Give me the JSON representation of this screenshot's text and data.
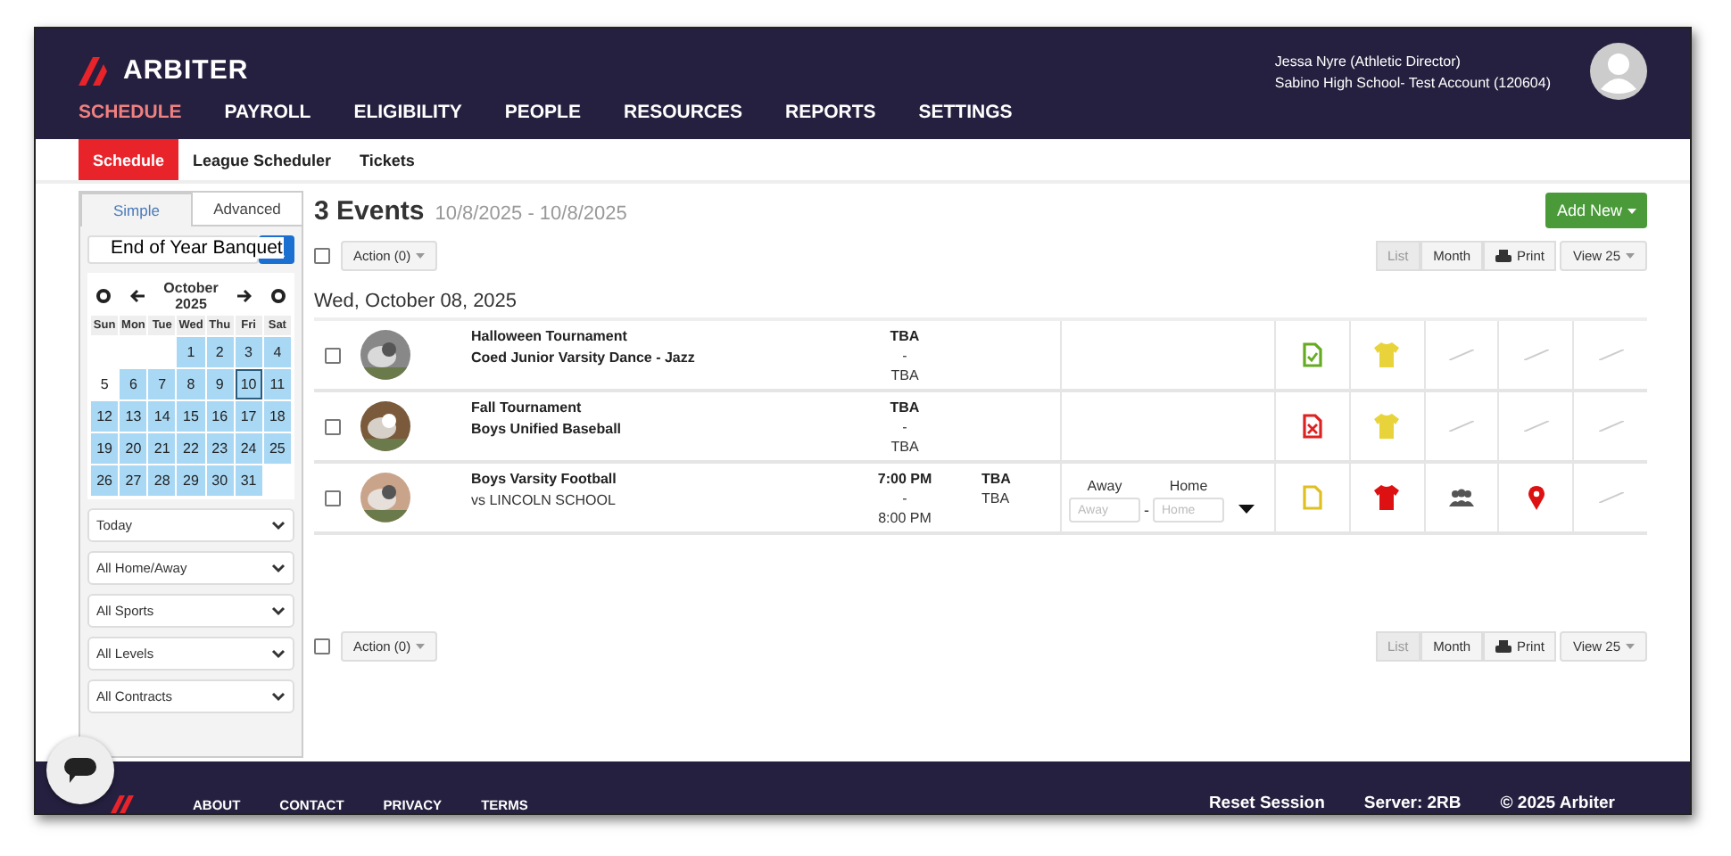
{
  "header": {
    "logo": "ARBITER",
    "nav": [
      {
        "label": "SCHEDULE",
        "selected": true
      },
      {
        "label": "PAYROLL",
        "selected": false
      },
      {
        "label": "ELIGIBILITY",
        "selected": false
      },
      {
        "label": "PEOPLE",
        "selected": false
      },
      {
        "label": "RESOURCES",
        "selected": false
      },
      {
        "label": "REPORTS",
        "selected": false
      },
      {
        "label": "SETTINGS",
        "selected": false
      }
    ],
    "user": {
      "name": "Jessa Nyre (Athletic Director)",
      "account": "Sabino High School- Test Account (120604)"
    }
  },
  "subnav": [
    {
      "label": "Schedule",
      "selected": true
    },
    {
      "label": "League Scheduler",
      "selected": false
    },
    {
      "label": "Tickets",
      "selected": false
    }
  ],
  "sidebar": {
    "tabs": [
      {
        "label": "Simple",
        "selected": true
      },
      {
        "label": "Advanced",
        "selected": false
      }
    ],
    "tooltip": "End of Year Banquet",
    "calendar": {
      "month": "October",
      "year": "2025",
      "weekdays": [
        "Sun",
        "Mon",
        "Tue",
        "Wed",
        "Thu",
        "Fri",
        "Sat"
      ],
      "days": [
        {
          "kind": "blank"
        },
        {
          "kind": "blank"
        },
        {
          "kind": "blank"
        },
        {
          "kind": "day",
          "label": "1",
          "highlighted": true,
          "selected": false
        },
        {
          "kind": "day",
          "label": "2",
          "highlighted": true,
          "selected": false
        },
        {
          "kind": "day",
          "label": "3",
          "highlighted": true,
          "selected": false
        },
        {
          "kind": "day",
          "label": "4",
          "highlighted": true,
          "selected": false
        },
        {
          "kind": "day",
          "label": "5",
          "highlighted": false,
          "selected": false
        },
        {
          "kind": "day",
          "label": "6",
          "highlighted": true,
          "selected": false
        },
        {
          "kind": "day",
          "label": "7",
          "highlighted": true,
          "selected": false
        },
        {
          "kind": "day",
          "label": "8",
          "highlighted": true,
          "selected": false
        },
        {
          "kind": "day",
          "label": "9",
          "highlighted": true,
          "selected": false
        },
        {
          "kind": "day",
          "label": "10",
          "highlighted": true,
          "selected": true
        },
        {
          "kind": "day",
          "label": "11",
          "highlighted": true,
          "selected": false
        },
        {
          "kind": "day",
          "label": "12",
          "highlighted": true,
          "selected": false
        },
        {
          "kind": "day",
          "label": "13",
          "highlighted": true,
          "selected": false
        },
        {
          "kind": "day",
          "label": "14",
          "highlighted": true,
          "selected": false
        },
        {
          "kind": "day",
          "label": "15",
          "highlighted": true,
          "selected": false
        },
        {
          "kind": "day",
          "label": "16",
          "highlighted": true,
          "selected": false
        },
        {
          "kind": "day",
          "label": "17",
          "highlighted": true,
          "selected": false
        },
        {
          "kind": "day",
          "label": "18",
          "highlighted": true,
          "selected": false
        },
        {
          "kind": "day",
          "label": "19",
          "highlighted": true,
          "selected": false
        },
        {
          "kind": "day",
          "label": "20",
          "highlighted": true,
          "selected": false
        },
        {
          "kind": "day",
          "label": "21",
          "highlighted": true,
          "selected": false
        },
        {
          "kind": "day",
          "label": "22",
          "highlighted": true,
          "selected": false
        },
        {
          "kind": "day",
          "label": "23",
          "highlighted": true,
          "selected": false
        },
        {
          "kind": "day",
          "label": "24",
          "highlighted": true,
          "selected": false
        },
        {
          "kind": "day",
          "label": "25",
          "highlighted": true,
          "selected": false
        },
        {
          "kind": "day",
          "label": "26",
          "highlighted": true,
          "selected": false
        },
        {
          "kind": "day",
          "label": "27",
          "highlighted": true,
          "selected": false
        },
        {
          "kind": "day",
          "label": "28",
          "highlighted": true,
          "selected": false
        },
        {
          "kind": "day",
          "label": "29",
          "highlighted": true,
          "selected": false
        },
        {
          "kind": "day",
          "label": "30",
          "highlighted": true,
          "selected": false
        },
        {
          "kind": "day",
          "label": "31",
          "highlighted": true,
          "selected": false
        }
      ]
    },
    "filters": [
      "Today",
      "All Home/Away",
      "All Sports",
      "All Levels",
      "All Contracts"
    ]
  },
  "main": {
    "count": "3 Events",
    "range": "10/8/2025 - 10/8/2025",
    "add_button": "Add New",
    "toolbars": [
      {
        "checked": false,
        "action_button": "Action (0)",
        "views": [
          {
            "label": "List",
            "selected": true
          },
          {
            "label": "Month",
            "selected": false
          },
          {
            "label": "Print",
            "selected": false
          }
        ],
        "page_size": "View 25"
      },
      {
        "checked": false,
        "action_button": "Action (0)",
        "views": [
          {
            "label": "List",
            "selected": true
          },
          {
            "label": "Month",
            "selected": false
          },
          {
            "label": "Print",
            "selected": false
          }
        ],
        "page_size": "View 25"
      }
    ],
    "date_heading": "Wed, October 08, 2025",
    "events": [
      {
        "checked": false,
        "title": "Halloween Tournament",
        "subtitle": "Coed Junior Varsity Dance - Jazz",
        "subtitle_bold": true,
        "start": "TBA",
        "dash": "-",
        "end": "TBA",
        "contract": {
          "kind": "signed",
          "color": "#66aa22"
        },
        "jersey": {
          "color": "#e8d43a"
        },
        "slots": [
          {
            "kind": "none"
          },
          {
            "kind": "none"
          },
          {
            "kind": "none"
          }
        ]
      },
      {
        "checked": false,
        "title": "Fall Tournament",
        "subtitle": "Boys Unified Baseball",
        "subtitle_bold": true,
        "start": "TBA",
        "dash": "-",
        "end": "TBA",
        "contract": {
          "kind": "rejected",
          "color": "#dd2222"
        },
        "jersey": {
          "color": "#e8d43a"
        },
        "slots": [
          {
            "kind": "none"
          },
          {
            "kind": "none"
          },
          {
            "kind": "none"
          }
        ]
      },
      {
        "checked": false,
        "title": "Boys Varsity Football",
        "subtitle": "vs LINCOLN SCHOOL",
        "subtitle_bold": false,
        "start": "7:00 PM",
        "dash": "-",
        "end": "8:00 PM",
        "location": [
          "TBA",
          "TBA"
        ],
        "score": {
          "labels": [
            "Away",
            "Home"
          ],
          "placeholders": [
            "Away",
            "Home"
          ],
          "dash": "-"
        },
        "contract": {
          "kind": "pending",
          "color": "#e0c020"
        },
        "jersey": {
          "color": "#dd1111"
        },
        "slots": [
          {
            "kind": "officials"
          },
          {
            "kind": "location"
          },
          {
            "kind": "none"
          }
        ]
      }
    ]
  },
  "footer": {
    "links": [
      "ABOUT",
      "CONTACT",
      "PRIVACY",
      "TERMS"
    ],
    "right": [
      "Reset Session",
      "Server: 2RB",
      "© 2025 Arbiter"
    ]
  }
}
